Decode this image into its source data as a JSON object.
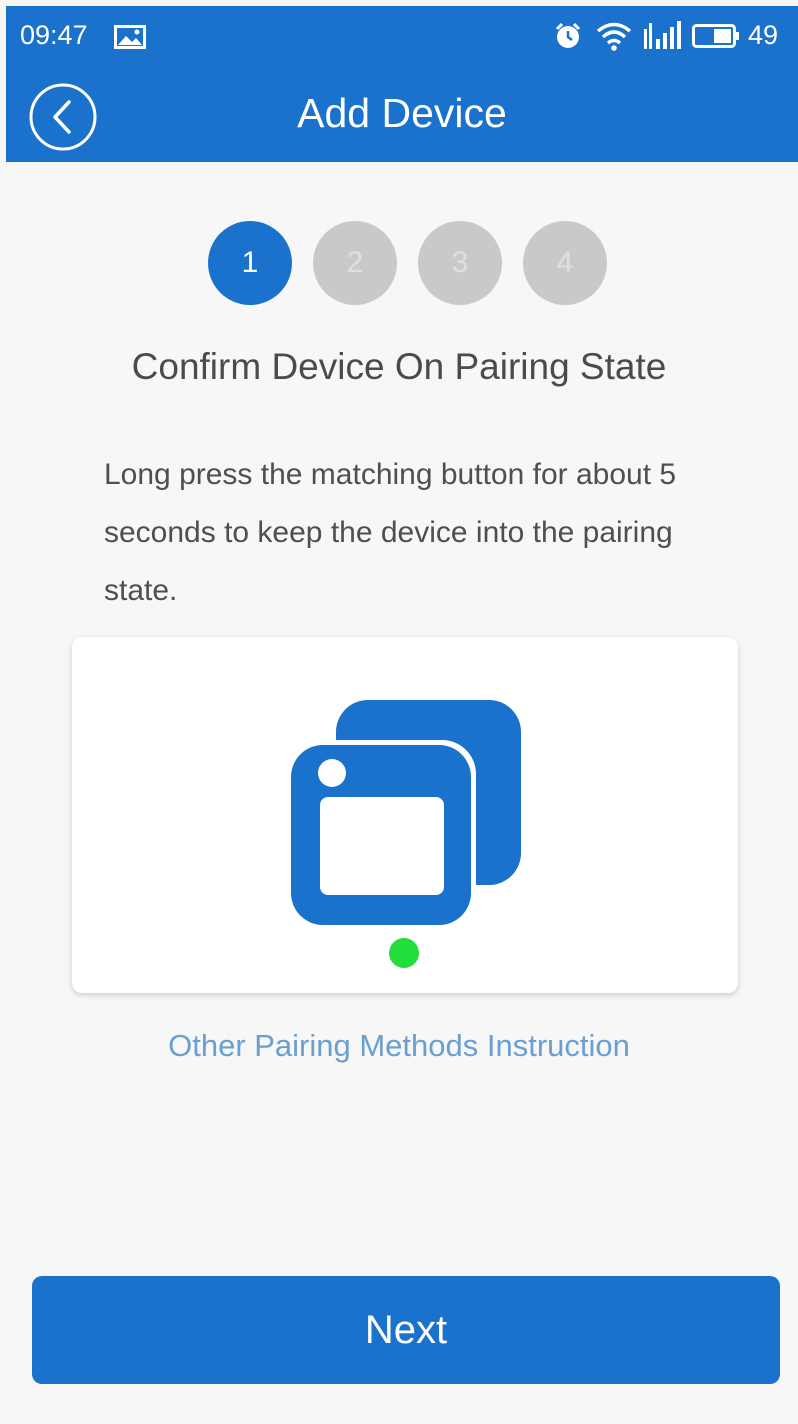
{
  "status_bar": {
    "time": "09:47",
    "battery_level": "49",
    "icons": [
      "gallery-icon",
      "alarm-icon",
      "wifi-icon",
      "signal-icon",
      "battery-icon"
    ]
  },
  "header": {
    "title": "Add Device",
    "back_icon": "chevron-left-circle-icon"
  },
  "steps": {
    "items": [
      "1",
      "2",
      "3",
      "4"
    ],
    "current": 1
  },
  "content": {
    "heading": "Confirm Device On Pairing State",
    "description": "Long press the matching button for about 5 seconds to keep the device into the pairing state.",
    "illustration_icon": "device-pairing-icon",
    "link_label": "Other Pairing Methods Instruction"
  },
  "footer": {
    "next_label": "Next"
  },
  "colors": {
    "primary": "#1a72cc",
    "link": "#6a9fd2",
    "step_inactive": "#c9c9c9",
    "indicator_led": "#22dd3a"
  }
}
